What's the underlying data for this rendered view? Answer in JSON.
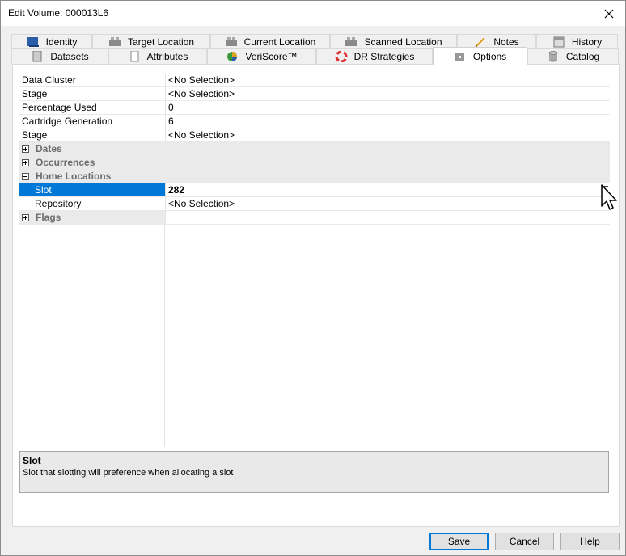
{
  "window": {
    "title": "Edit Volume: 000013L6"
  },
  "tabs_row1": [
    {
      "label": "Identity",
      "icon": "identity-icon"
    },
    {
      "label": "Target Location",
      "icon": "target-location-icon"
    },
    {
      "label": "Current Location",
      "icon": "current-location-icon"
    },
    {
      "label": "Scanned Location",
      "icon": "scanned-location-icon"
    },
    {
      "label": "Notes",
      "icon": "pencil-icon"
    },
    {
      "label": "History",
      "icon": "calendar-icon"
    }
  ],
  "tabs_row2": [
    {
      "label": "Datasets",
      "icon": "document-icon"
    },
    {
      "label": "Attributes",
      "icon": "page-icon"
    },
    {
      "label": "VeriScore™",
      "icon": "veriscore-icon"
    },
    {
      "label": "DR Strategies",
      "icon": "lifebuoy-icon"
    },
    {
      "label": "Options",
      "icon": "options-icon",
      "active": true
    },
    {
      "label": "Catalog",
      "icon": "database-icon"
    }
  ],
  "properties": {
    "data_cluster": {
      "name": "Data Cluster",
      "value": "<No Selection>"
    },
    "stage": {
      "name": "Stage",
      "value": "<No Selection>"
    },
    "percentage_used": {
      "name": "Percentage Used",
      "value": "0"
    },
    "cartridge_generation": {
      "name": "Cartridge Generation",
      "value": "6"
    },
    "stage2": {
      "name": "Stage",
      "value": "<No Selection>"
    },
    "dates": {
      "name": "Dates",
      "expanded": false
    },
    "occurrences": {
      "name": "Occurrences",
      "expanded": false
    },
    "home_locations": {
      "name": "Home Locations",
      "expanded": true
    },
    "slot": {
      "name": "Slot",
      "value": "282",
      "selected": true
    },
    "repository": {
      "name": "Repository",
      "value": "<No Selection>"
    },
    "flags": {
      "name": "Flags",
      "expanded": false
    }
  },
  "description": {
    "title": "Slot",
    "text": "Slot that slotting will preference when allocating a slot"
  },
  "buttons": {
    "save": "Save",
    "cancel": "Cancel",
    "help": "Help"
  },
  "colors": {
    "selection": "#0078d7",
    "category_bg": "#eaeaea",
    "category_text": "#6d6d6d"
  }
}
